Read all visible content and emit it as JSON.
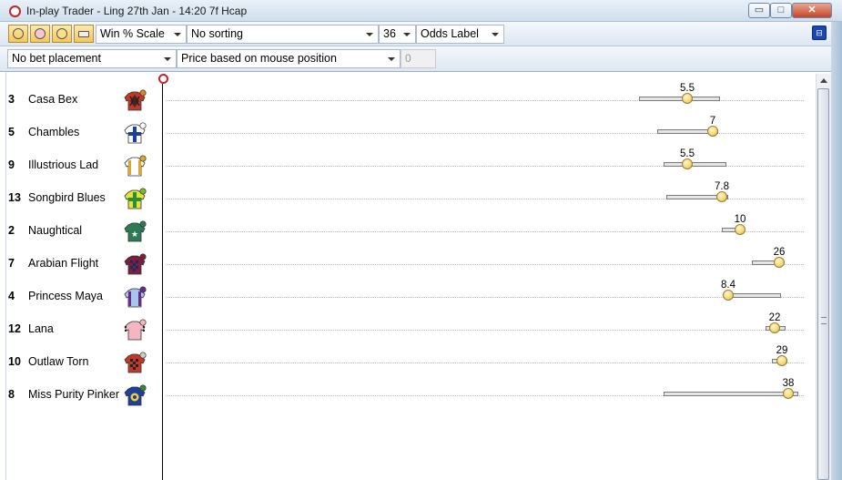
{
  "window": {
    "title": "In-play Trader - Ling 27th Jan - 14:20 7f Hcap",
    "minimize_glyph": "▭",
    "maximize_glyph": "□",
    "close_glyph": "✕"
  },
  "toolbar": {
    "scale_select": "Win % Scale",
    "sorting_select": "No sorting",
    "size_select": "36",
    "label_select": "Odds Label",
    "pin_glyph": "⊟"
  },
  "toolbar2": {
    "bet_select": "No bet placement",
    "price_select": "Price based on mouse position",
    "stake_value": "0"
  },
  "accent_colors": {
    "close": "#c4452b",
    "marker": "#c0262b",
    "knob": "#f3d774"
  },
  "runners": [
    {
      "number": "3",
      "name": "Casa Bex",
      "odds": "5.5",
      "silk": {
        "body": "#c0392b",
        "pattern": "diamond",
        "secondary": "#222",
        "cap": "#e67e22"
      }
    },
    {
      "number": "5",
      "name": "Chambles",
      "odds": "7",
      "silk": {
        "body": "#ffffff",
        "pattern": "cross",
        "secondary": "#1f3f9e",
        "cap": "#ffffff"
      }
    },
    {
      "number": "9",
      "name": "Illustrious Lad",
      "odds": "5.5",
      "silk": {
        "body": "#ffffff",
        "pattern": "sides",
        "secondary": "#e0a52b",
        "cap": "#e0a52b"
      }
    },
    {
      "number": "13",
      "name": "Songbird Blues",
      "odds": "7.8",
      "silk": {
        "body": "#e3e33a",
        "pattern": "cross",
        "secondary": "#2e8b3a",
        "cap": "#6cbf2e"
      }
    },
    {
      "number": "2",
      "name": "Naughtical",
      "odds": "10",
      "silk": {
        "body": "#2e7a55",
        "pattern": "star",
        "secondary": "#ffffff",
        "cap": "#2e7a55"
      }
    },
    {
      "number": "7",
      "name": "Arabian Flight",
      "odds": "26",
      "silk": {
        "body": "#7b1f3f",
        "pattern": "check",
        "secondary": "#1a2a6c",
        "cap": "#7b1f3f"
      }
    },
    {
      "number": "4",
      "name": "Princess Maya",
      "odds": "8.4",
      "silk": {
        "body": "#a7c6ee",
        "pattern": "sides",
        "secondary": "#6a2a8c",
        "cap": "#6a2a8c"
      }
    },
    {
      "number": "12",
      "name": "Lana",
      "odds": "22",
      "silk": {
        "body": "#f4b6c2",
        "pattern": "sleeves",
        "secondary": "#222",
        "cap": "#f4b6c2"
      }
    },
    {
      "number": "10",
      "name": "Outlaw Torn",
      "odds": "29",
      "silk": {
        "body": "#c0392b",
        "pattern": "check",
        "secondary": "#222",
        "cap": "#cccccc"
      }
    },
    {
      "number": "8",
      "name": "Miss Purity Pinker",
      "odds": "38",
      "silk": {
        "body": "#1f3f9e",
        "pattern": "ball",
        "secondary": "#f1d130",
        "cap": "#2e8b3a"
      }
    }
  ]
}
